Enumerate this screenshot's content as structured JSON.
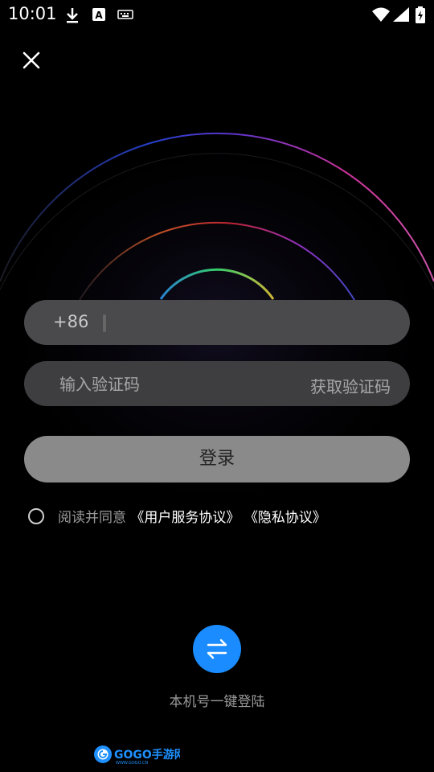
{
  "status_bar": {
    "time": "10:01",
    "icons": [
      "download-icon",
      "text-a-icon",
      "keyboard-icon",
      "wifi-icon",
      "signal-icon",
      "battery-charging-icon"
    ]
  },
  "close_icon": "close-icon",
  "phone": {
    "country_code": "+86",
    "value": ""
  },
  "code": {
    "placeholder": "输入验证码",
    "value": "",
    "get_code_label": "获取验证码"
  },
  "login": {
    "label": "登录"
  },
  "agreement": {
    "prefix": "阅读并同意",
    "user_agreement": "《用户服务协议》",
    "privacy": "《隐私协议》",
    "checked": false
  },
  "one_click": {
    "icon": "swap-arrows-icon",
    "label": "本机号一键登陆",
    "color": "#1a8cff"
  },
  "watermark": {
    "text": "GOGO手游网",
    "sub": "WWW.GOGO.CN"
  }
}
